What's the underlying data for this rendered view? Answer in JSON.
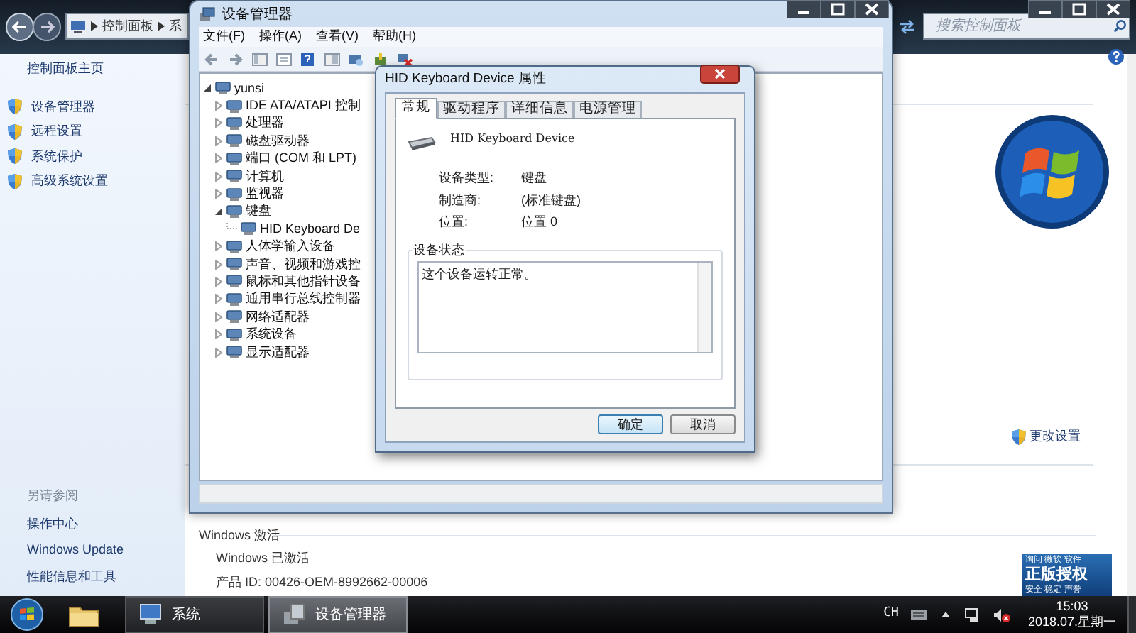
{
  "control_panel": {
    "breadcrumb": [
      "控制面板",
      "系"
    ],
    "search": {
      "placeholder": "搜索控制面板"
    },
    "sidebar": {
      "home": "控制面板主页",
      "links": [
        "设备管理器",
        "远程设置",
        "系统保护",
        "高级系统设置"
      ],
      "see_also_title": "另请参阅",
      "see_also": [
        "操作中心",
        "Windows Update",
        "性能信息和工具"
      ]
    },
    "change_settings": "更改设置",
    "activation": {
      "heading": "Windows 激活",
      "status": "Windows 已激活",
      "product_id": "产品 ID: 00426-OEM-8992662-00006"
    },
    "genuine_badge": {
      "top": "询问 微软 软件",
      "main": "正版授权",
      "bottom": "安全 稳定 声誉"
    }
  },
  "device_manager": {
    "title": "设备管理器",
    "menu": [
      "文件(F)",
      "操作(A)",
      "查看(V)",
      "帮助(H)"
    ],
    "tree": {
      "label": "yunsi",
      "expanded": true,
      "children": [
        {
          "label": "IDE ATA/ATAPI 控制",
          "expanded": false
        },
        {
          "label": "处理器",
          "expanded": false
        },
        {
          "label": "磁盘驱动器",
          "expanded": false
        },
        {
          "label": "端口 (COM 和 LPT)",
          "expanded": false
        },
        {
          "label": "计算机",
          "expanded": false
        },
        {
          "label": "监视器",
          "expanded": false
        },
        {
          "label": "键盘",
          "expanded": true,
          "children": [
            {
              "label": "HID Keyboard De"
            }
          ]
        },
        {
          "label": "人体学输入设备",
          "expanded": false
        },
        {
          "label": "声音、视频和游戏控",
          "expanded": false
        },
        {
          "label": "鼠标和其他指针设备",
          "expanded": false
        },
        {
          "label": "通用串行总线控制器",
          "expanded": false
        },
        {
          "label": "网络适配器",
          "expanded": false
        },
        {
          "label": "系统设备",
          "expanded": false
        },
        {
          "label": "显示适配器",
          "expanded": false
        }
      ]
    }
  },
  "properties_dialog": {
    "title": "HID Keyboard Device 属性",
    "tabs": [
      {
        "label": "常规",
        "selected": true
      },
      {
        "label": "驱动程序",
        "selected": false
      },
      {
        "label": "详细信息",
        "selected": false
      },
      {
        "label": "电源管理",
        "selected": false
      }
    ],
    "device_name": "HID Keyboard Device",
    "properties": [
      {
        "label": "设备类型:",
        "value": "键盘"
      },
      {
        "label": "制造商:",
        "value": "(标准键盘)"
      },
      {
        "label": "位置:",
        "value": "位置 0"
      }
    ],
    "status_group": "设备状态",
    "status_text": "这个设备运转正常。",
    "buttons": [
      {
        "label": "确定",
        "default": true
      },
      {
        "label": "取消",
        "default": false
      }
    ]
  },
  "taskbar": {
    "items": [
      {
        "label": "系统",
        "selected": false
      },
      {
        "label": "设备管理器",
        "selected": true
      }
    ],
    "language": "CH",
    "time": "15:03",
    "date": "2018.07.星期一"
  }
}
